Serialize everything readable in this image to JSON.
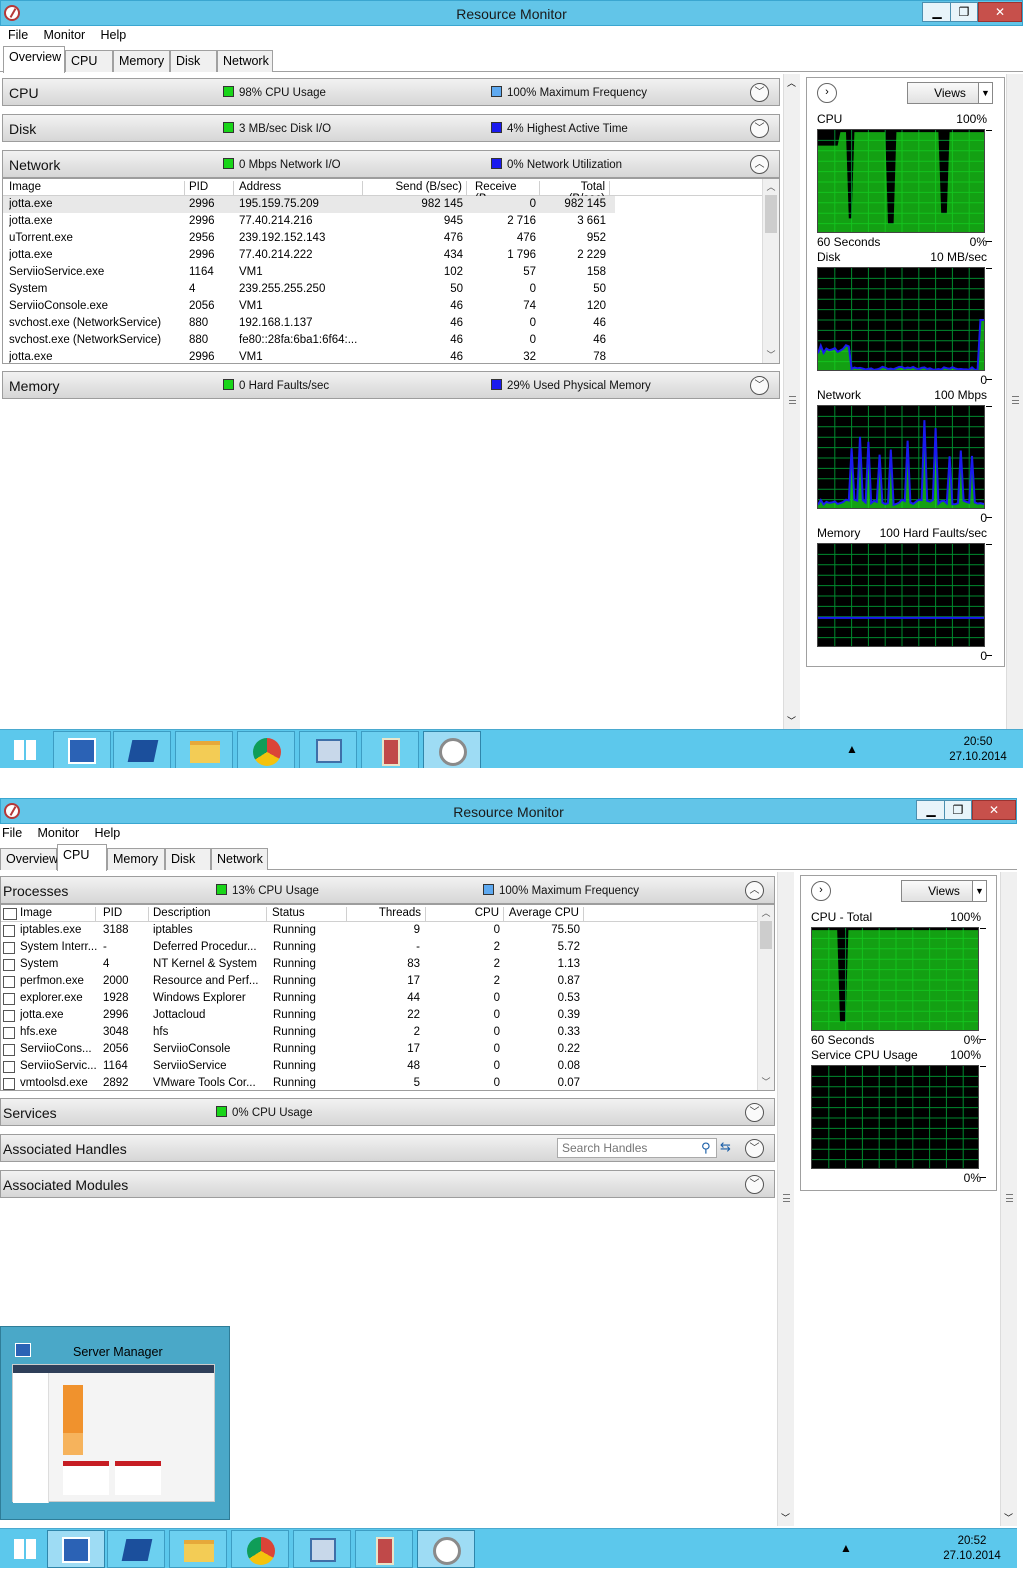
{
  "window": {
    "title": "Resource Monitor",
    "min": "▁",
    "max": "❐",
    "close": "✕"
  },
  "menu": [
    "File",
    "Monitor",
    "Help"
  ],
  "tabs": [
    "Overview",
    "CPU",
    "Memory",
    "Disk",
    "Network"
  ],
  "colors": {
    "green": "#19d519",
    "blue": "#1a1aef",
    "lightblue": "#5ea9f0",
    "graph_bg": "#000000",
    "grid": "#008a2e",
    "taskbar": "#5cc8ec"
  },
  "shot1": {
    "cpu": {
      "name": "CPU",
      "stat1": "98% CPU Usage",
      "stat2": "100% Maximum Frequency"
    },
    "disk": {
      "name": "Disk",
      "stat1": "3 MB/sec Disk I/O",
      "stat2": "4% Highest Active Time"
    },
    "network": {
      "name": "Network",
      "stat1": "0 Mbps Network I/O",
      "stat2": "0% Network Utilization",
      "columns": [
        "Image",
        "PID",
        "Address",
        "Send (B/sec)",
        "Receive (B...",
        "Total (B/sec)"
      ],
      "rows": [
        [
          "jotta.exe",
          "2996",
          "195.159.75.209",
          "982 145",
          "0",
          "982 145"
        ],
        [
          "jotta.exe",
          "2996",
          "77.40.214.216",
          "945",
          "2 716",
          "3 661"
        ],
        [
          "uTorrent.exe",
          "2956",
          "239.192.152.143",
          "476",
          "476",
          "952"
        ],
        [
          "jotta.exe",
          "2996",
          "77.40.214.222",
          "434",
          "1 796",
          "2 229"
        ],
        [
          "ServiioService.exe",
          "1164",
          "VM1",
          "102",
          "57",
          "158"
        ],
        [
          "System",
          "4",
          "239.255.255.250",
          "50",
          "0",
          "50"
        ],
        [
          "ServiioConsole.exe",
          "2056",
          "VM1",
          "46",
          "74",
          "120"
        ],
        [
          "svchost.exe (NetworkService)",
          "880",
          "192.168.1.137",
          "46",
          "0",
          "46"
        ],
        [
          "svchost.exe (NetworkService)",
          "880",
          "fe80::28fa:6ba1:6f64:...",
          "46",
          "0",
          "46"
        ],
        [
          "jotta.exe",
          "2996",
          "VM1",
          "46",
          "32",
          "78"
        ]
      ]
    },
    "memory": {
      "name": "Memory",
      "stat1": "0 Hard Faults/sec",
      "stat2": "29% Used Physical Memory"
    },
    "views": "Views",
    "graphs": [
      {
        "name": "CPU",
        "max": "100%",
        "footer_left": "60 Seconds",
        "footer_right": "0%"
      },
      {
        "name": "Disk",
        "max": "10 MB/sec",
        "footer_left": "",
        "footer_right": "0"
      },
      {
        "name": "Network",
        "max": "100 Mbps",
        "footer_left": "",
        "footer_right": "0"
      },
      {
        "name": "Memory",
        "max": "100 Hard Faults/sec",
        "footer_left": "",
        "footer_right": "0"
      }
    ],
    "clock": {
      "time": "20:50",
      "date": "27.10.2014"
    }
  },
  "shot2": {
    "processes": {
      "name": "Processes",
      "stat1": "13% CPU Usage",
      "stat2": "100% Maximum Frequency",
      "columns": [
        "Image",
        "PID",
        "Description",
        "Status",
        "Threads",
        "CPU",
        "Average CPU"
      ],
      "rows": [
        [
          "iptables.exe",
          "3188",
          "iptables",
          "Running",
          "9",
          "0",
          "75.50"
        ],
        [
          "System Interr...",
          "-",
          "Deferred Procedur...",
          "Running",
          "-",
          "2",
          "5.72"
        ],
        [
          "System",
          "4",
          "NT Kernel & System",
          "Running",
          "83",
          "2",
          "1.13"
        ],
        [
          "perfmon.exe",
          "2000",
          "Resource and Perf...",
          "Running",
          "17",
          "2",
          "0.87"
        ],
        [
          "explorer.exe",
          "1928",
          "Windows Explorer",
          "Running",
          "44",
          "0",
          "0.53"
        ],
        [
          "jotta.exe",
          "2996",
          "Jottacloud",
          "Running",
          "22",
          "0",
          "0.39"
        ],
        [
          "hfs.exe",
          "3048",
          "hfs",
          "Running",
          "2",
          "0",
          "0.33"
        ],
        [
          "ServiioCons...",
          "2056",
          "ServiioConsole",
          "Running",
          "17",
          "0",
          "0.22"
        ],
        [
          "ServiioServic...",
          "1164",
          "ServiioService",
          "Running",
          "48",
          "0",
          "0.08"
        ],
        [
          "vmtoolsd.exe",
          "2892",
          "VMware Tools Cor...",
          "Running",
          "5",
          "0",
          "0.07"
        ]
      ]
    },
    "services": {
      "name": "Services",
      "stat1": "0% CPU Usage"
    },
    "handles": {
      "name": "Associated Handles",
      "search_placeholder": "Search Handles"
    },
    "modules": {
      "name": "Associated Modules"
    },
    "views": "Views",
    "graphs": [
      {
        "name": "CPU - Total",
        "max": "100%",
        "footer_left": "60 Seconds",
        "footer_right": "0%"
      },
      {
        "name": "Service CPU Usage",
        "max": "100%",
        "footer_left": "",
        "footer_right": "0%"
      }
    ],
    "preview_title": "Server Manager",
    "clock": {
      "time": "20:52",
      "date": "27.10.2014"
    }
  }
}
